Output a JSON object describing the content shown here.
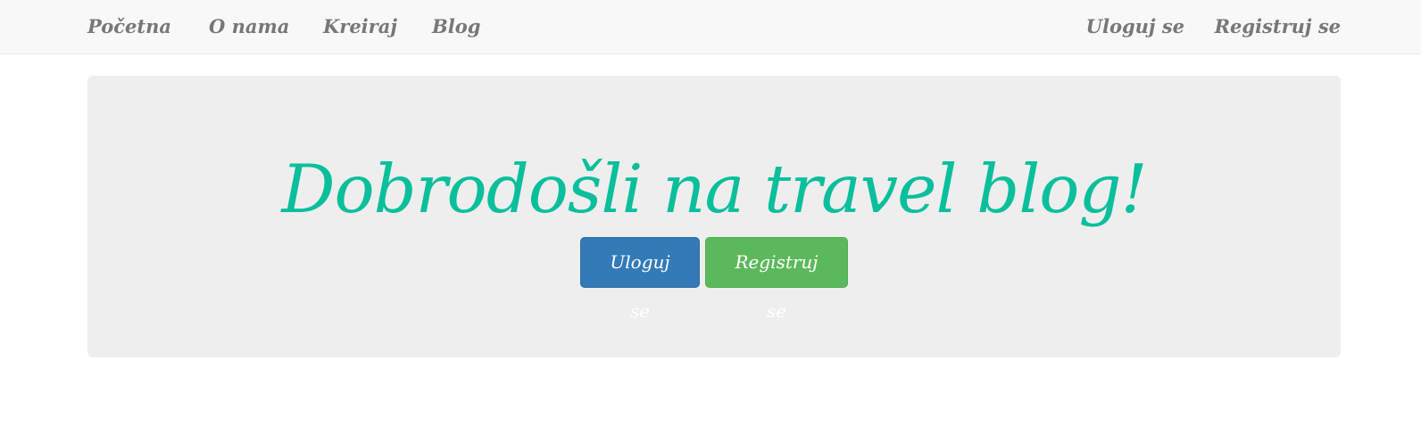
{
  "navbar": {
    "left_links": [
      "Početna",
      "O nama",
      "Kreiraj",
      "Blog"
    ],
    "right_links": [
      "Uloguj se",
      "Registruj se"
    ]
  },
  "hero": {
    "title": "Dobrodošli na travel blog!",
    "login_button": "Uloguj se",
    "register_button": "Registruj se"
  },
  "colors": {
    "navbar_bg": "#f8f8f8",
    "nav_text": "#777777",
    "jumbotron_bg": "#eeeeee",
    "title_color": "#0abf9c",
    "primary_button": "#337ab7",
    "success_button": "#5cb85c"
  }
}
